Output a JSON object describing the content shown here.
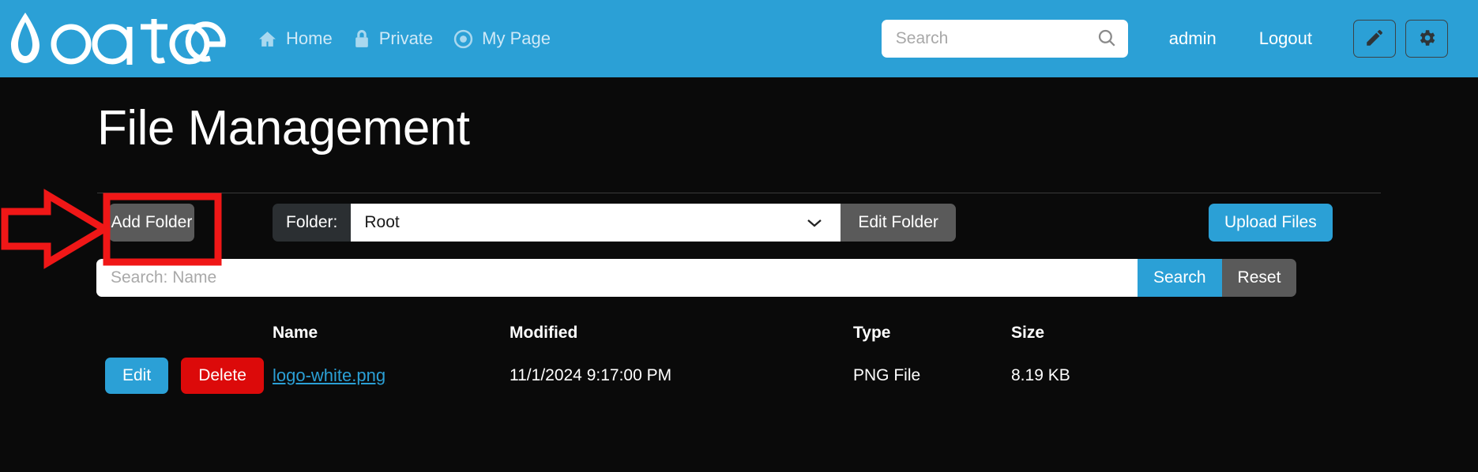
{
  "header": {
    "brand_name": "oqtane",
    "brand_icon": "water-drop-logo",
    "nav": [
      {
        "label": "Home",
        "icon": "home-icon"
      },
      {
        "label": "Private",
        "icon": "lock-icon"
      },
      {
        "label": "My Page",
        "icon": "target-circle-icon"
      }
    ],
    "search": {
      "placeholder": "Search",
      "value": "",
      "icon": "search-icon"
    },
    "user_label": "admin",
    "logout_label": "Logout",
    "edit_button_icon": "pencil-icon",
    "settings_button_icon": "gear-icon",
    "background_color": "#2ba0d6"
  },
  "page": {
    "title": "File Management"
  },
  "toolbar": {
    "add_folder_label": "Add Folder",
    "folder_label": "Folder:",
    "folder_value": "Root",
    "folder_chevron_icon": "chevron-down-icon",
    "edit_folder_label": "Edit Folder",
    "upload_files_label": "Upload Files"
  },
  "search_row": {
    "placeholder": "Search: Name",
    "value": "",
    "search_label": "Search",
    "reset_label": "Reset"
  },
  "table": {
    "columns": [
      "Name",
      "Modified",
      "Type",
      "Size"
    ],
    "rows": [
      {
        "edit_label": "Edit",
        "delete_label": "Delete",
        "name": "logo-white.png",
        "modified": "11/1/2024 9:17:00 PM",
        "type": "PNG File",
        "size": "8.19 KB"
      }
    ]
  },
  "annotation": {
    "type": "red-arrow-and-box",
    "target": "Add Folder",
    "color": "#f01717"
  },
  "colors": {
    "accent_blue": "#2ba0d6",
    "danger_red": "#dc0a0a",
    "secondary_gray": "#5a5a5a",
    "dark_gray": "#2b2f32",
    "page_background": "#0a0a0a",
    "annotation_red": "#f01717"
  }
}
